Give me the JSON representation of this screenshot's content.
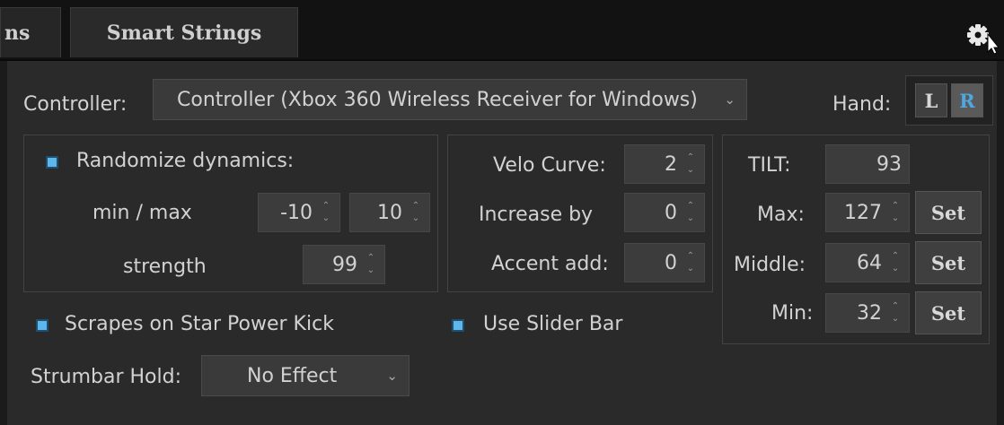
{
  "tabs": {
    "partial_label": "ns",
    "active_label": "Smart Strings"
  },
  "icons": {
    "settings": "gear-icon",
    "cursor": "mouse-pointer-icon",
    "checkbox": "checkbox-checked-icon",
    "dropdown": "chevron-down-icon",
    "spinner": "up-down-arrows-icon"
  },
  "colors": {
    "accent": "#5fb6ea",
    "selected_text": "#4fa7e0"
  },
  "controller": {
    "label": "Controller:",
    "value": "Controller (Xbox 360 Wireless Receiver for Windows)"
  },
  "hand": {
    "label": "Hand:",
    "left": "L",
    "right": "R",
    "selected": "R"
  },
  "randomize": {
    "label": "Randomize dynamics:",
    "checked": true,
    "minmax_label": "min / max",
    "min": "-10",
    "max": "10",
    "strength_label": "strength",
    "strength": "99"
  },
  "velocity": {
    "curve_label": "Velo Curve:",
    "curve": "2",
    "increase_label": "Increase by",
    "increase": "0",
    "accent_label": "Accent add:",
    "accent": "0"
  },
  "tilt": {
    "label": "TILT:",
    "value": "93",
    "max_label": "Max:",
    "max": "127",
    "middle_label": "Middle:",
    "middle": "64",
    "min_label": "Min:",
    "min": "32",
    "set_label": "Set"
  },
  "scrapes": {
    "label": "Scrapes on Star Power Kick",
    "checked": true
  },
  "slider_bar": {
    "label": "Use Slider Bar",
    "checked": true
  },
  "strumbar": {
    "label": "Strumbar Hold:",
    "value": "No Effect"
  }
}
